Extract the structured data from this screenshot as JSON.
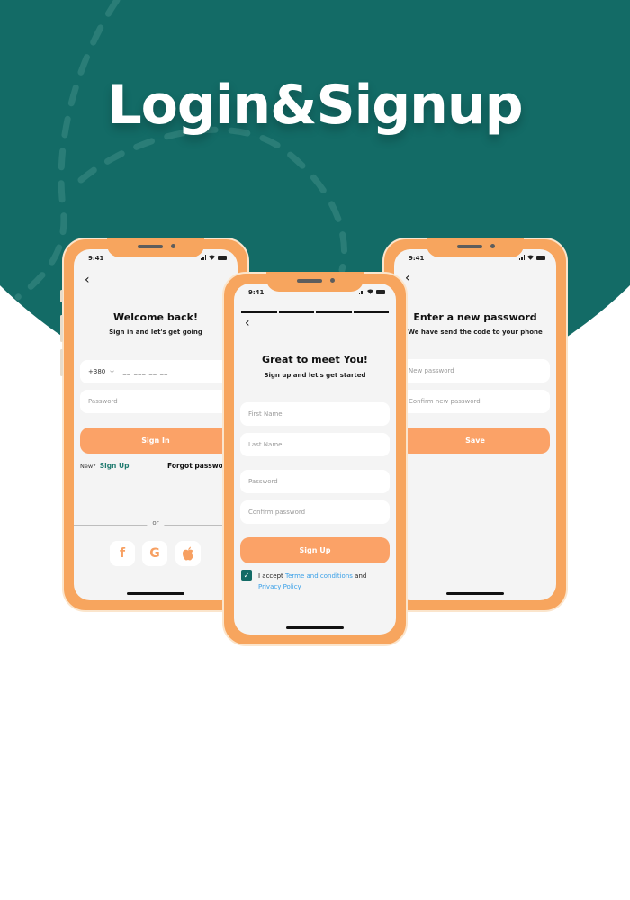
{
  "title": "Login&Signup",
  "colors": {
    "teal": "#136b66",
    "orange": "#f7a55e",
    "button": "#fba267",
    "link_teal": "#1f7a6f",
    "link_blue": "#3aa0e8"
  },
  "status_bar": {
    "time": "9:41"
  },
  "login": {
    "title": "Welcome back!",
    "subtitle": "Sign in and let's get going",
    "country_code": "+380",
    "phone_placeholder": "__ ___ __ __",
    "password_placeholder": "Password",
    "sign_in": "Sign In",
    "new_label": "New?",
    "sign_up_link": "Sign Up",
    "forgot": "Forgot password",
    "or": "or",
    "social": [
      {
        "icon": "facebook-icon",
        "glyph": "f"
      },
      {
        "icon": "google-icon",
        "glyph": "G"
      },
      {
        "icon": "apple-icon",
        "glyph": ""
      }
    ]
  },
  "signup": {
    "title": "Great to meet You!",
    "subtitle": "Sign up and let's get started",
    "first_name": "First Name",
    "last_name": "Last Name",
    "password": "Password",
    "confirm_password": "Confirm password",
    "sign_up": "Sign Up",
    "accept_prefix": "I accept",
    "terms_link": "Terme and conditions",
    "and": "and",
    "privacy_link": "Privacy Policy",
    "accepted": true
  },
  "reset": {
    "title": "Enter a new password",
    "subtitle": "We have send the code to your phone",
    "new_password": "New password",
    "confirm_new_password": "Confirm new password",
    "save": "Save"
  }
}
